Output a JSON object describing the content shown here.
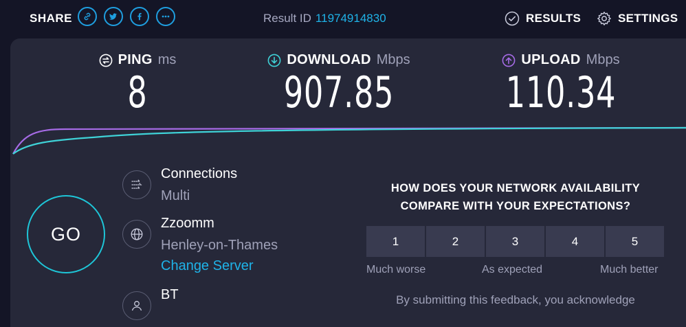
{
  "header": {
    "share_label": "SHARE",
    "result_id_label": "Result ID",
    "result_id_value": "11974914830",
    "results_label": "RESULTS",
    "settings_label": "SETTINGS"
  },
  "metrics": {
    "ping": {
      "name": "PING",
      "unit": "ms",
      "value": "8"
    },
    "download": {
      "name": "DOWNLOAD",
      "unit": "Mbps",
      "value": "907.85"
    },
    "upload": {
      "name": "UPLOAD",
      "unit": "Mbps",
      "value": "110.34"
    }
  },
  "colors": {
    "accent": "#1fb3e8",
    "download": "#3fd3d8",
    "upload": "#a66be6",
    "go_ring": "#1ec6d8"
  },
  "go_label": "GO",
  "connection": {
    "connections_label": "Connections",
    "connections_value": "Multi",
    "host_name": "Zzoomm",
    "host_location": "Henley-on-Thames",
    "change_server_label": "Change Server",
    "isp_name": "BT"
  },
  "survey": {
    "question_line1": "HOW DOES YOUR NETWORK AVAILABILITY",
    "question_line2": "COMPARE WITH YOUR EXPECTATIONS?",
    "ratings": [
      "1",
      "2",
      "3",
      "4",
      "5"
    ],
    "label_low": "Much worse",
    "label_mid": "As expected",
    "label_high": "Much better",
    "disclaimer": "By submitting this feedback, you acknowledge"
  }
}
